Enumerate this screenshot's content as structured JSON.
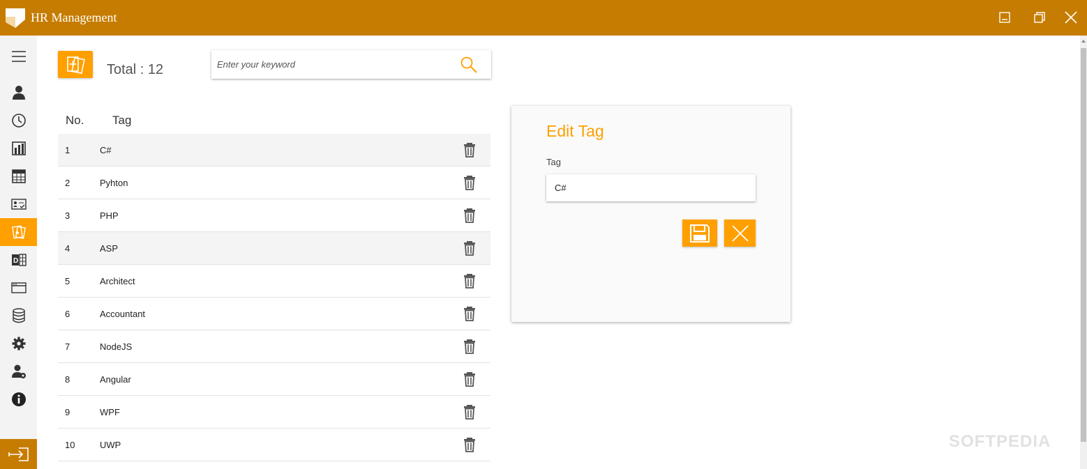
{
  "window": {
    "title": "HR Management",
    "accent": "#c67c00",
    "highlight": "#ffa000"
  },
  "sidebar": {
    "items": [
      {
        "icon": "menu-icon"
      },
      {
        "icon": "employee-icon"
      },
      {
        "icon": "clock-icon"
      },
      {
        "icon": "bar-chart-icon"
      },
      {
        "icon": "calendar-icon"
      },
      {
        "icon": "id-card-icon"
      },
      {
        "icon": "tag-cards-icon",
        "active": true
      },
      {
        "icon": "department-icon"
      },
      {
        "icon": "window-icon"
      },
      {
        "icon": "database-icon"
      },
      {
        "icon": "gear-icon"
      },
      {
        "icon": "user-settings-icon"
      },
      {
        "icon": "info-icon"
      }
    ],
    "logout_icon": "logout-icon"
  },
  "toolbar": {
    "total_label": "Total : 12",
    "search_placeholder": "Enter your keyword"
  },
  "table": {
    "headers": {
      "no": "No.",
      "tag": "Tag"
    },
    "rows": [
      {
        "no": "1",
        "tag": "C#"
      },
      {
        "no": "2",
        "tag": "Pyhton"
      },
      {
        "no": "3",
        "tag": "PHP"
      },
      {
        "no": "4",
        "tag": "ASP"
      },
      {
        "no": "5",
        "tag": "Architect"
      },
      {
        "no": "6",
        "tag": "Accountant"
      },
      {
        "no": "7",
        "tag": "NodeJS"
      },
      {
        "no": "8",
        "tag": "Angular"
      },
      {
        "no": "9",
        "tag": "WPF"
      },
      {
        "no": "10",
        "tag": "UWP"
      }
    ]
  },
  "edit_panel": {
    "title": "Edit Tag",
    "field_label": "Tag",
    "field_value": "C#"
  },
  "watermark": "SOFTPEDIA"
}
